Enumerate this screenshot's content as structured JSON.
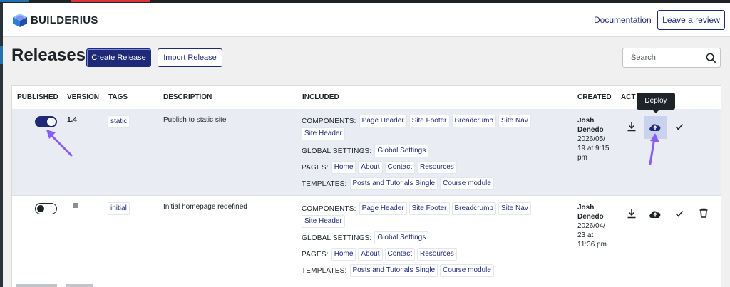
{
  "colors": {
    "accent": "#1e2a78",
    "arrow": "#8a5cf6",
    "deploy_highlight": "#c9d3ee"
  },
  "header": {
    "logo_text": "BUILDERIUS",
    "documentation_label": "Documentation",
    "review_label": "Leave a review"
  },
  "page": {
    "title": "Releases",
    "create_label": "Create Release",
    "import_label": "Import Release",
    "search_placeholder": "Search"
  },
  "table": {
    "columns": [
      "PUBLISHED",
      "VERSION",
      "TAGS",
      "DESCRIPTION",
      "INCLUDED",
      "CREATED",
      "ACT"
    ],
    "tooltip": "Deploy",
    "labels": {
      "components": "COMPONENTS:",
      "global": "GLOBAL SETTINGS:",
      "pages": "PAGES:",
      "templates": "TEMPLATES:"
    },
    "rows": [
      {
        "published": true,
        "version": "1.4",
        "tag": "static",
        "description": "Publish to static site",
        "components": [
          "Page Header",
          "Site Footer",
          "Breadcrumb",
          "Site Nav",
          "Site Header"
        ],
        "global_settings": [
          "Global Settings"
        ],
        "pages": [
          "Home",
          "About",
          "Contact",
          "Resources"
        ],
        "templates": [
          "Posts and Tutorials Single",
          "Course module"
        ],
        "created_by": [
          "Josh",
          "Denedo"
        ],
        "created_at": [
          "2026/05/",
          "19 at 9:15",
          "pm"
        ]
      },
      {
        "published": false,
        "version": "",
        "tag": "initial",
        "description": "Initial homepage redefined",
        "components": [
          "Page Header",
          "Site Footer",
          "Breadcrumb",
          "Site Nav",
          "Site Header"
        ],
        "global_settings": [
          "Global Settings"
        ],
        "pages": [
          "Home",
          "About",
          "Contact",
          "Resources"
        ],
        "templates": [
          "Posts and Tutorials Single",
          "Course module"
        ],
        "created_by": [
          "Josh",
          "Denedo"
        ],
        "created_at": [
          "2026/04/",
          "23 at",
          "11:36 pm"
        ]
      }
    ]
  }
}
